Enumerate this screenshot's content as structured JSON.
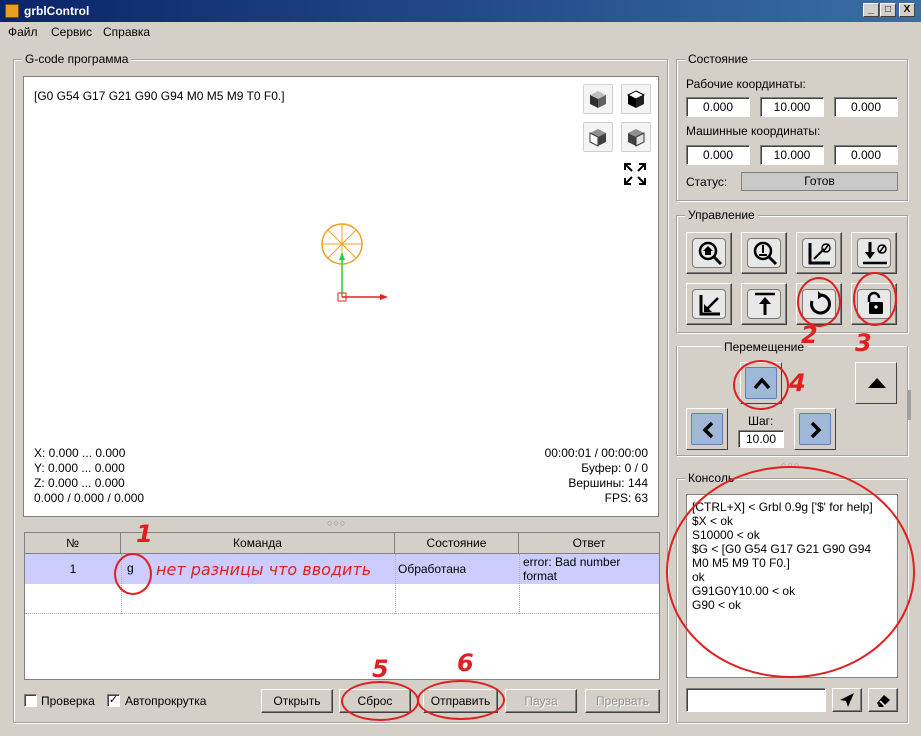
{
  "window": {
    "title": "grblControl",
    "minimize": "_",
    "maximize": "□",
    "close": "X"
  },
  "menu": [
    "Файл",
    "Сервис",
    "Справка"
  ],
  "gcode_group": {
    "title": "G-code программа",
    "header_line": "[G0 G54 G17 G21 G90 G94 M0 M5 M9 T0 F0.]",
    "coords": [
      "X: 0.000 ... 0.000",
      "Y: 0.000 ... 0.000",
      "Z: 0.000 ... 0.000",
      "0.000 / 0.000 / 0.000"
    ],
    "stats": [
      "00:00:01 / 00:00:00",
      "Буфер: 0 / 0",
      "Вершины: 144",
      "FPS: 63"
    ]
  },
  "table": {
    "columns": [
      "№",
      "Команда",
      "Состояние",
      "Ответ"
    ],
    "rows": [
      {
        "num": "1",
        "command": "g",
        "state": "Обработана",
        "answer": "error: Bad number format"
      }
    ]
  },
  "annotation": {
    "text": "нет разницы что вводить",
    "nums": [
      "1",
      "2",
      "3",
      "4",
      "5",
      "6"
    ]
  },
  "bottom_bar": {
    "check_label": "Проверка",
    "autoscroll_label": "Автопрокрутка",
    "autoscroll_checked": "✓",
    "buttons": [
      "Открыть",
      "Сброс",
      "Отправить",
      "Пауза",
      "Прервать"
    ]
  },
  "state_group": {
    "title": "Состояние",
    "work_label": "Рабочие координаты:",
    "work": [
      "0.000",
      "10.000",
      "0.000"
    ],
    "machine_label": "Машинные координаты:",
    "machine": [
      "0.000",
      "10.000",
      "0.000"
    ],
    "status_label": "Статус:",
    "status": "Готов"
  },
  "control_group": {
    "title": "Управление"
  },
  "jog_group": {
    "title": "Перемещение",
    "step_label": "Шаг:",
    "step": "10.00"
  },
  "console_group": {
    "title": "Консоль",
    "lines": [
      "[CTRL+X] < Grbl 0.9g ['$' for help]",
      "$X < ok",
      "S10000 < ok",
      "$G < [G0 G54 G17 G21 G90 G94",
      "M0 M5 M9 T0 F0.]",
      "ok",
      "G91G0Y10.00 < ok",
      "G90 < ok"
    ]
  },
  "colors": {
    "accent_red": "#e02020",
    "selection": "#ccccff",
    "jog_blue": "#9fb8d8"
  }
}
